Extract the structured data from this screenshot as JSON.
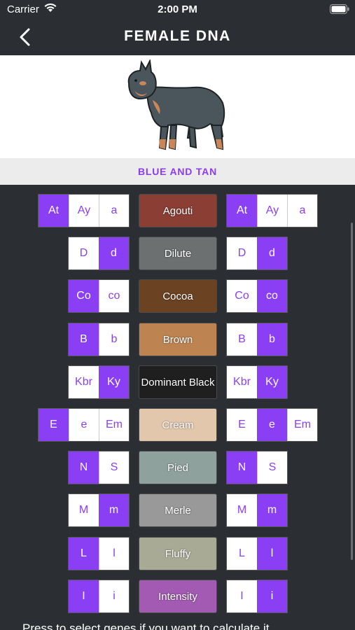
{
  "status": {
    "carrier": "Carrier",
    "time": "2:00 PM"
  },
  "nav": {
    "title": "FEMALE DNA"
  },
  "color_name": "BLUE AND TAN",
  "rows": [
    {
      "locus": "Agouti",
      "color": "#8a3e34",
      "left": [
        {
          "t": "At",
          "on": true
        },
        {
          "t": "Ay",
          "on": false
        },
        {
          "t": "a",
          "on": false
        }
      ],
      "right": [
        {
          "t": "At",
          "on": true
        },
        {
          "t": "Ay",
          "on": false
        },
        {
          "t": "a",
          "on": false
        }
      ]
    },
    {
      "locus": "Dilute",
      "color": "#6c7071",
      "left": [
        {
          "t": "D",
          "on": false
        },
        {
          "t": "d",
          "on": true
        }
      ],
      "right": [
        {
          "t": "D",
          "on": false
        },
        {
          "t": "d",
          "on": true
        }
      ]
    },
    {
      "locus": "Cocoa",
      "color": "#6b4322",
      "left": [
        {
          "t": "Co",
          "on": true
        },
        {
          "t": "co",
          "on": false
        }
      ],
      "right": [
        {
          "t": "Co",
          "on": false
        },
        {
          "t": "co",
          "on": true
        }
      ]
    },
    {
      "locus": "Brown",
      "color": "#bd8452",
      "left": [
        {
          "t": "B",
          "on": true
        },
        {
          "t": "b",
          "on": false
        }
      ],
      "right": [
        {
          "t": "B",
          "on": false
        },
        {
          "t": "b",
          "on": true
        }
      ]
    },
    {
      "locus": "Dominant Black",
      "color": "#1f1f1f",
      "left": [
        {
          "t": "Kbr",
          "on": false
        },
        {
          "t": "Ky",
          "on": true
        }
      ],
      "right": [
        {
          "t": "Kbr",
          "on": false
        },
        {
          "t": "Ky",
          "on": true
        }
      ]
    },
    {
      "locus": "Cream",
      "color": "#e3c7ad",
      "left": [
        {
          "t": "E",
          "on": true
        },
        {
          "t": "e",
          "on": false
        },
        {
          "t": "Em",
          "on": false
        }
      ],
      "right": [
        {
          "t": "E",
          "on": false
        },
        {
          "t": "e",
          "on": true
        },
        {
          "t": "Em",
          "on": false
        }
      ]
    },
    {
      "locus": "Pied",
      "color": "#8fa19d",
      "left": [
        {
          "t": "N",
          "on": true
        },
        {
          "t": "S",
          "on": false
        }
      ],
      "right": [
        {
          "t": "N",
          "on": true
        },
        {
          "t": "S",
          "on": false
        }
      ]
    },
    {
      "locus": "Merle",
      "color": "#999999",
      "left": [
        {
          "t": "M",
          "on": false
        },
        {
          "t": "m",
          "on": true
        }
      ],
      "right": [
        {
          "t": "M",
          "on": false
        },
        {
          "t": "m",
          "on": true
        }
      ]
    },
    {
      "locus": "Fluffy",
      "color": "#a9aa96",
      "left": [
        {
          "t": "L",
          "on": true
        },
        {
          "t": "l",
          "on": false
        }
      ],
      "right": [
        {
          "t": "L",
          "on": false
        },
        {
          "t": "l",
          "on": true
        }
      ]
    },
    {
      "locus": "Intensity",
      "color": "#a35ab3",
      "left": [
        {
          "t": "I",
          "on": true
        },
        {
          "t": "i",
          "on": false
        }
      ],
      "right": [
        {
          "t": "I",
          "on": false
        },
        {
          "t": "i",
          "on": true
        }
      ]
    }
  ],
  "footer": "Press to select genes if you want to calculate it"
}
